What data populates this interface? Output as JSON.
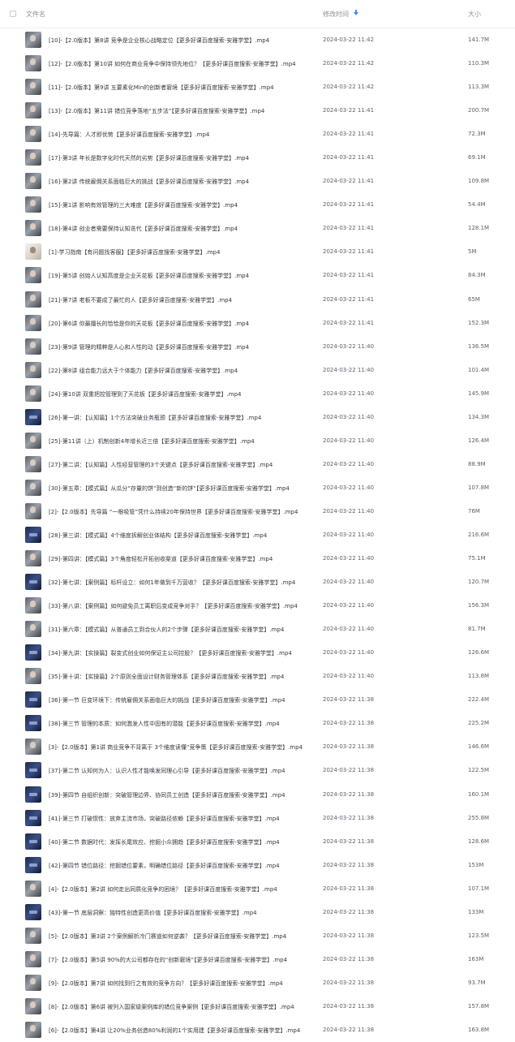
{
  "header": {
    "name": "文件名",
    "modified": "修改时间",
    "size": "大小"
  },
  "files": [
    {
      "name": "[10]-【2.0版本】第8讲 竞争是企业核心战略定位【更多好课百度搜索-安雅学堂】.mp4",
      "time": "2024-03-22 11:42",
      "size": "141.7M",
      "thumb": "video"
    },
    {
      "name": "[12]-【2.0版本】第10讲 如何在商业竞争中保持领先地位？【更多好课百度搜索-安雅学堂】.mp4",
      "time": "2024-03-22 11:42",
      "size": "110.3M",
      "thumb": "video"
    },
    {
      "name": "[11]-【2.0版本】第9讲 五要素化Min的创新者窘境【更多好课百度搜索-安雅学堂】.mp4",
      "time": "2024-03-22 11:42",
      "size": "113.3M",
      "thumb": "video"
    },
    {
      "name": "[13]-【2.0版本】第11讲 错位竞争落地“五步法”【更多好课百度搜索-安雅学堂】.mp4",
      "time": "2024-03-22 11:41",
      "size": "200.7M",
      "thumb": "video"
    },
    {
      "name": "[14]-先导篇：人才即优势【更多好课百度搜索-安雅学堂】.mp4",
      "time": "2024-03-22 11:41",
      "size": "72.3M",
      "thumb": "video"
    },
    {
      "name": "[17]-第3讲 年长是数字化时代天然的劣势【更多好课百度搜索-安雅学堂】.mp4",
      "time": "2024-03-22 11:41",
      "size": "69.1M",
      "thumb": "video"
    },
    {
      "name": "[16]-第2讲 传统雇佣关系面临巨大的挑战【更多好课百度搜索-安雅学堂】.mp4",
      "time": "2024-03-22 11:41",
      "size": "109.8M",
      "thumb": "video"
    },
    {
      "name": "[15]-第1讲 影响有效管理的三大难度【更多好课百度搜索-安雅学堂】.mp4",
      "time": "2024-03-22 11:41",
      "size": "54.4M",
      "thumb": "video"
    },
    {
      "name": "[18]-第4讲 创业者需要保持认知迭代【更多好课百度搜索-安雅学堂】.mp4",
      "time": "2024-03-22 11:41",
      "size": "128.1M",
      "thumb": "video"
    },
    {
      "name": "[1]-学习指南【有问题找客服】【更多好课百度搜索-安雅学堂】.mp4",
      "time": "2024-03-22 11:41",
      "size": "5M",
      "thumb": "light"
    },
    {
      "name": "[19]-第5讲 创始人认知高度是企业天花板【更多好课百度搜索-安雅学堂】.mp4",
      "time": "2024-03-22 11:41",
      "size": "84.3M",
      "thumb": "video"
    },
    {
      "name": "[21]-第7讲 老板不要成了最忙的人【更多好课百度搜索-安雅学堂】.mp4",
      "time": "2024-03-22 11:41",
      "size": "65M",
      "thumb": "video"
    },
    {
      "name": "[20]-第6讲 你最擅长的恰恰是你的天花板【更多好课百度搜索-安雅学堂】.mp4",
      "time": "2024-03-22 11:41",
      "size": "152.3M",
      "thumb": "video"
    },
    {
      "name": "[23]-第9讲 管理的精粹是人心和人性的动【更多好课百度搜索-安雅学堂】.mp4",
      "time": "2024-03-22 11:40",
      "size": "136.5M",
      "thumb": "video"
    },
    {
      "name": "[22]-第8讲 组合能力远大于个体能力【更多好课百度搜索-安雅学堂】.mp4",
      "time": "2024-03-22 11:40",
      "size": "101.4M",
      "thumb": "video"
    },
    {
      "name": "[24]-第10讲 双重把控管理到了天花板【更多好课百度搜索-安雅学堂】.mp4",
      "time": "2024-03-22 11:40",
      "size": "145.9M",
      "thumb": "video"
    },
    {
      "name": "[26]-第一讲：【认知篇】1个方法突破业务瓶颈【更多好课百度搜索-安雅学堂】.mp4",
      "time": "2024-03-22 11:40",
      "size": "134.3M",
      "thumb": "dark"
    },
    {
      "name": "[25]-第11讲（上）机制创新4年增长近三倍【更多好课百度搜索-安雅学堂】.mp4",
      "time": "2024-03-22 11:40",
      "size": "126.4M",
      "thumb": "video"
    },
    {
      "name": "[27]-第二讲：【认知篇】人性经营管理的3个关键点【更多好课百度搜索-安雅学堂】.mp4",
      "time": "2024-03-22 11:40",
      "size": "88.9M",
      "thumb": "video"
    },
    {
      "name": "[30]-第五章：【模式篇】从瓜分“存量的饼”到创造“新的饼”【更多好课百度搜索-安雅学堂】.mp4",
      "time": "2024-03-22 11:40",
      "size": "107.8M",
      "thumb": "video"
    },
    {
      "name": "[2]-【2.0版本】先导篇 “一根吸管”凭什么持续20年保持世界【更多好课百度搜索-安雅学堂】.mp4",
      "time": "2024-03-22 11:40",
      "size": "76M",
      "thumb": "video"
    },
    {
      "name": "[28]-第三讲：【模式篇】4个维度拆解创业体结构【更多好课百度搜索-安雅学堂】.mp4",
      "time": "2024-03-22 11:40",
      "size": "216.6M",
      "thumb": "dark"
    },
    {
      "name": "[29]-第四讲：【模式篇】3个角度轻松开拓创收渠道【更多好课百度搜索-安雅学堂】.mp4",
      "time": "2024-03-22 11:40",
      "size": "75.1M",
      "thumb": "video"
    },
    {
      "name": "[32]-第七讲：【案例篇】标杆设立：如何1年做到千万营收？【更多好课百度搜索-安雅学堂】.mp4",
      "time": "2024-03-22 11:40",
      "size": "120.7M",
      "thumb": "dark"
    },
    {
      "name": "[33]-第八讲：【案例篇】如何避免员工离职后变成竞争对手？【更多好课百度搜索-安雅学堂】.mp4",
      "time": "2024-03-22 11:40",
      "size": "156.3M",
      "thumb": "video"
    },
    {
      "name": "[31]-第六章：【模式篇】从普通员工到合伙人的2个步骤【更多好课百度搜索-安雅学堂】.mp4",
      "time": "2024-03-22 11:40",
      "size": "81.7M",
      "thumb": "video"
    },
    {
      "name": "[34]-第九讲：【实操篇】裂变式创业如何保证主公司控股？【更多好课百度搜索-安雅学堂】.mp4",
      "time": "2024-03-22 11:40",
      "size": "126.6M",
      "thumb": "dark"
    },
    {
      "name": "[35]-第十讲：【实操篇】2个原则全面设计财务管理体系【更多好课百度搜索-安雅学堂】.mp4",
      "time": "2024-03-22 11:40",
      "size": "113.8M",
      "thumb": "video"
    },
    {
      "name": "[36]-第一节 巨变环境下：传统雇佣关系面临巨大的挑战【更多好课百度搜索-安雅学堂】.mp4",
      "time": "2024-03-22 11:38",
      "size": "222.4M",
      "thumb": "dark"
    },
    {
      "name": "[38]-第三节 管理的本质：如何激发人性中固有的潜能【更多好课百度搜索-安雅学堂】.mp4",
      "time": "2024-03-22 11:38",
      "size": "225.2M",
      "thumb": "dark"
    },
    {
      "name": "[3]-【2.0版本】第1讲 商业竞争不背离于 3个维度读懂“竞争策【更多好课百度搜索-安雅学堂】.mp4",
      "time": "2024-03-22 11:38",
      "size": "146.6M",
      "thumb": "video"
    },
    {
      "name": "[37]-第二节 认知何为人：认识人性才能唤发同理心引导【更多好课百度搜索-安雅学堂】.mp4",
      "time": "2024-03-22 11:38",
      "size": "122.5M",
      "thumb": "dark"
    },
    {
      "name": "[39]-第四节 自组织创新：突破管理边界、协同员工创造【更多好课百度搜索-安雅学堂】.mp4",
      "time": "2024-03-22 11:38",
      "size": "160.1M",
      "thumb": "dark"
    },
    {
      "name": "[41]-第三节 打破惯性：放弃主流市场，突破路径依赖【更多好课百度搜索-安雅学堂】.mp4",
      "time": "2024-03-22 11:38",
      "size": "255.8M",
      "thumb": "dark"
    },
    {
      "name": "[40]-第二节 数据时代：发挥长尾效应、挖掘小众拥趋【更多好课百度搜索-安雅学堂】.mp4",
      "time": "2024-03-22 11:38",
      "size": "128.6M",
      "thumb": "dark"
    },
    {
      "name": "[42]-第四节 错位路径：挖掘错位要素，明确错位路径【更多好课百度搜索-安雅学堂】.mp4",
      "time": "2024-03-22 11:38",
      "size": "153M",
      "thumb": "dark"
    },
    {
      "name": "[4]-【2.0版本】第2讲 如何走出同质化竞争的困境？【更多好课百度搜索-安雅学堂】.mp4",
      "time": "2024-03-22 11:38",
      "size": "107.1M",
      "thumb": "video"
    },
    {
      "name": "[43]-第一节 底层洞察：独特性创造更高价值【更多好课百度搜索-安雅学堂】.mp4",
      "time": "2024-03-22 11:38",
      "size": "133M",
      "thumb": "dark"
    },
    {
      "name": "[5]-【2.0版本】第3讲 2个案例解析冷门赛道如何逆袭？【更多好课百度搜索-安雅学堂】.mp4",
      "time": "2024-03-22 11:38",
      "size": "123.5M",
      "thumb": "video"
    },
    {
      "name": "[7]-【2.0版本】第5讲 90%的大公司都存在的“创新窘境”【更多好课百度搜索-安雅学堂】.mp4",
      "time": "2024-03-22 11:38",
      "size": "163M",
      "thumb": "video"
    },
    {
      "name": "[9]-【2.0版本】第7讲 如何找到行之有效的竞争方向？【更多好课百度搜索-安雅学堂】.mp4",
      "time": "2024-03-22 11:38",
      "size": "93.7M",
      "thumb": "video"
    },
    {
      "name": "[8]-【2.0版本】第6讲 被列入国家级案例库的错位竞争案例【更多好课百度搜索-安雅学堂】.mp4",
      "time": "2024-03-22 11:38",
      "size": "157.8M",
      "thumb": "video"
    },
    {
      "name": "[6]-【2.0版本】第4讲 让20%业务创造80%利润的1个实用建【更多好课百度搜索-安雅学堂】.mp4",
      "time": "2024-03-22 11:38",
      "size": "163.8M",
      "thumb": "video"
    }
  ]
}
